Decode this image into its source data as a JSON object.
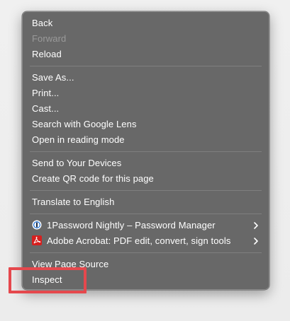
{
  "menu": {
    "back": "Back",
    "forward": "Forward",
    "reload": "Reload",
    "save_as": "Save As...",
    "print": "Print...",
    "cast": "Cast...",
    "search_google_lens": "Search with Google Lens",
    "reading_mode": "Open in reading mode",
    "send_devices": "Send to Your Devices",
    "qr_code": "Create QR code for this page",
    "translate": "Translate to English",
    "onepassword": "1Password Nightly – Password Manager",
    "acrobat": "Adobe Acrobat: PDF edit, convert, sign tools",
    "view_source": "View Page Source",
    "inspect": "Inspect"
  },
  "icons": {
    "onepassword": "onepassword-icon",
    "acrobat": "adobe-acrobat-icon",
    "submenu": "chevron-right-icon"
  },
  "colors": {
    "menu_bg": "#686868",
    "text": "#ffffff",
    "disabled_text": "#9a9a9a",
    "highlight_border": "#e5484d"
  }
}
